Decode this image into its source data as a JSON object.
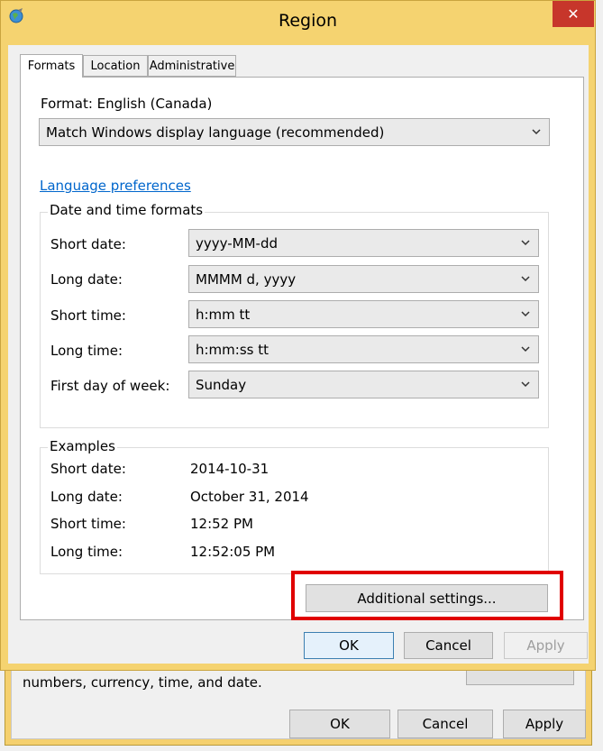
{
  "background_window": {
    "text": "numbers, currency, time, and date.",
    "ok_label": "OK",
    "cancel_label": "Cancel",
    "apply_label": "Apply"
  },
  "dialog": {
    "title": "Region",
    "close_glyph": "✕",
    "tabs": [
      {
        "label": "Formats"
      },
      {
        "label": "Location"
      },
      {
        "label": "Administrative"
      }
    ],
    "format": {
      "label": "Format: English (Canada)",
      "selected": "Match Windows display language (recommended)"
    },
    "language_link": "Language preferences",
    "date_time_group": {
      "title": "Date and time formats",
      "rows": [
        {
          "label": "Short date:",
          "value": "yyyy-MM-dd"
        },
        {
          "label": "Long date:",
          "value": "MMMM d, yyyy"
        },
        {
          "label": "Short time:",
          "value": "h:mm tt"
        },
        {
          "label": "Long time:",
          "value": "h:mm:ss tt"
        },
        {
          "label": "First day of week:",
          "value": "Sunday"
        }
      ]
    },
    "examples_group": {
      "title": "Examples",
      "rows": [
        {
          "label": "Short date:",
          "value": "2014-10-31"
        },
        {
          "label": "Long date:",
          "value": "October 31, 2014"
        },
        {
          "label": "Short time:",
          "value": "12:52 PM"
        },
        {
          "label": "Long time:",
          "value": "12:52:05 PM"
        }
      ]
    },
    "additional_settings_label": "Additional settings...",
    "ok_label": "OK",
    "cancel_label": "Cancel",
    "apply_label": "Apply"
  },
  "colors": {
    "title_bar": "#f5d370",
    "close_button": "#c7362b",
    "link": "#0066cc",
    "highlight_box": "#e00000"
  }
}
